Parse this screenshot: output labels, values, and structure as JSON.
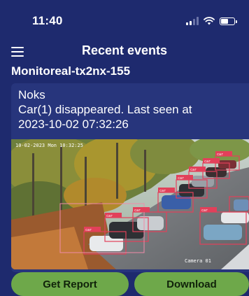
{
  "status_bar": {
    "time": "11:40",
    "signal_bars_filled": 2,
    "signal_bars_total": 4,
    "battery_level": 0.6
  },
  "header": {
    "title": "Recent events",
    "menu_icon": "hamburger-menu-icon"
  },
  "device": {
    "name": "Monitoreal-tx2nx-155"
  },
  "event": {
    "label": "Noks",
    "message_line1": "Car(1) disappeared. Last seen at",
    "message_line2": "2023-10-02 07:32:26",
    "snapshot": {
      "timestamp_overlay": "10-02-2023 Mon 10:32:25",
      "camera_overlay": "Camera 01",
      "detection_label": "car",
      "box_color_primary": "#e2405a",
      "box_color_secondary": "#f08aa8"
    }
  },
  "actions": {
    "get_report": "Get Report",
    "download": "Download"
  },
  "colors": {
    "background": "#1e2a6e",
    "card": "#27357c",
    "button": "#6ea84a",
    "button_text": "#10220a"
  }
}
